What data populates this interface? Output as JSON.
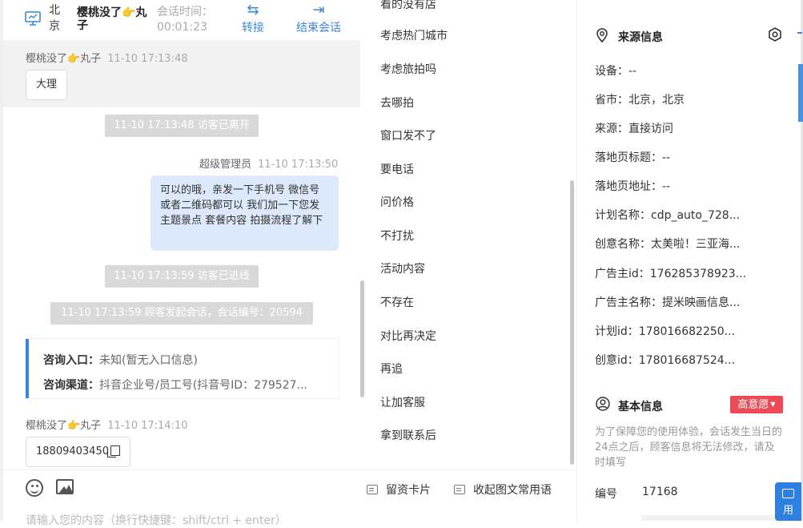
{
  "header": {
    "visitor_city": "北京",
    "visitor_name": "樱桃没了👉丸子",
    "session_time_label": "会话时间：",
    "session_time": "00:01:23",
    "transfer_label": "转接",
    "end_label": "结束会话"
  },
  "messages": {
    "m1_sender": "樱桃没了👉丸子",
    "m1_time": "11-10 17:13:48",
    "m1_text": "大理",
    "sys1": "11-10 17:13:48 访客已离开",
    "m2_sender": "超级管理员",
    "m2_time": "11-10 17:13:50",
    "m2_text": "可以的哦，亲发一下手机号 微信号或者二维码都可以 我们加一下您发主题景点 套餐内容 拍摄流程了解下",
    "sys2": "11-10 17:13:59 访客已进线",
    "sys3": "11-10 17:13:59 顾客发起会话，会话编号：20594",
    "card_entry_label": "咨询入口：",
    "card_entry_value": "未知(暂无入口信息)",
    "card_channel_label": "咨询渠道：",
    "card_channel_value": "抖音企业号/员工号(抖音号ID：279527...",
    "m3_sender": "樱桃没了👉丸子",
    "m3_time": "11-10 17:14:10",
    "m3_text": "18809403450"
  },
  "phrases": [
    "看的没有店",
    "考虑热门城市",
    "考虑旅拍吗",
    "去哪拍",
    "窗口发不了",
    "要电话",
    "问价格",
    "不打扰",
    "活动内容",
    "不存在",
    "对比再决定",
    "再追",
    "让加客服",
    "拿到联系后"
  ],
  "input": {
    "leave_card_label": "留资卡片",
    "collapse_label": "收起图文常用语",
    "placeholder": "请输入您的内容（换行快捷键：shift/ctrl + enter）"
  },
  "source_info": {
    "title": "来源信息",
    "rows": [
      "设备：--",
      "省市：北京，北京",
      "来源：直接访问",
      "落地页标题：--",
      "落地页地址：--",
      "计划名称：cdp_auto_728...",
      "创意名称：太美啦！三亚海...",
      "广告主id：176285378923...",
      "广告主名称：提米映画信息...",
      "计划id：178016682250...",
      "创意id：178016687524..."
    ]
  },
  "basic_info": {
    "title": "基本信息",
    "intent_badge": "高意愿",
    "notice": "为了保障您的使用体验，会话发生当日的24点之后，顾客信息将无法修改，请及时填写",
    "number_label": "编号",
    "number_value": "17168"
  },
  "float_button": {
    "label": "用"
  },
  "colors": {
    "accent": "#3a86d8",
    "badge": "#ec4b55",
    "bubble_out": "#dbe9fb",
    "system_msg": "#d9d9d9"
  }
}
